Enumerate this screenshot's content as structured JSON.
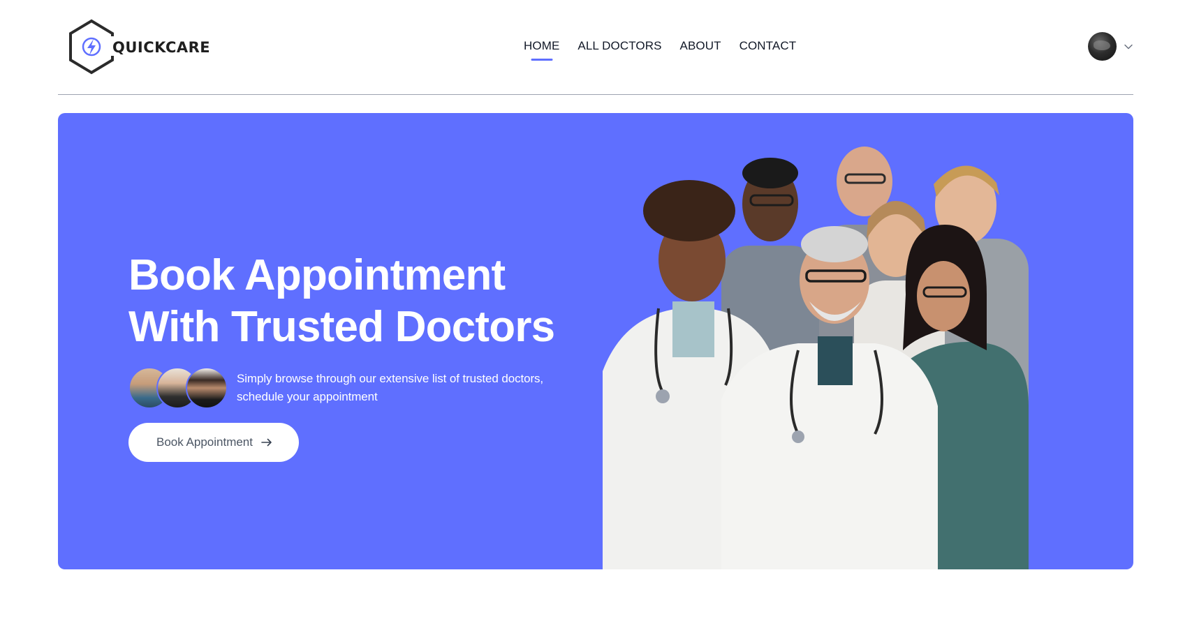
{
  "brand": {
    "name": "QUICKCARE",
    "accent": "#5f6fff"
  },
  "nav": {
    "items": [
      {
        "label": "HOME",
        "active": true
      },
      {
        "label": "ALL DOCTORS",
        "active": false
      },
      {
        "label": "ABOUT",
        "active": false
      },
      {
        "label": "CONTACT",
        "active": false
      }
    ]
  },
  "profile": {
    "avatar_icon": "user-avatar",
    "menu_icon": "chevron-down-icon"
  },
  "hero": {
    "title_line1": "Book Appointment",
    "title_line2": "With Trusted Doctors",
    "subtitle": "Simply browse through our extensive list of trusted doctors, schedule your appointment",
    "cta_label": "Book Appointment",
    "cta_icon": "arrow-right-icon",
    "background": "#5f6fff"
  }
}
